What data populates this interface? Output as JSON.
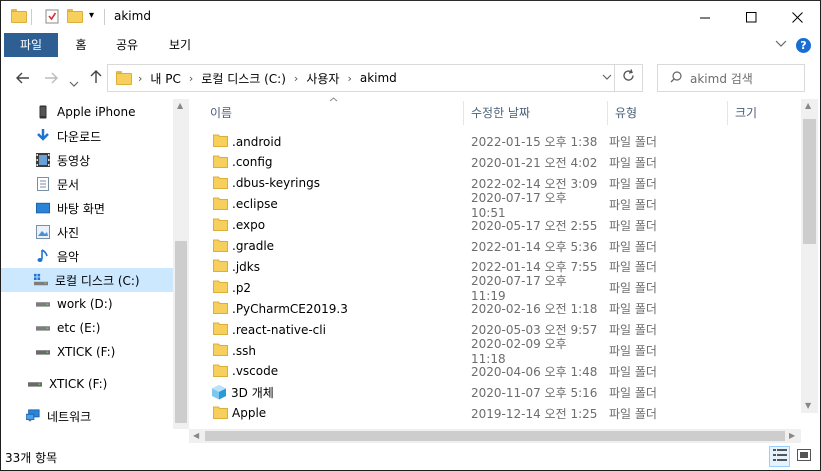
{
  "title": "akimd",
  "ribbon": {
    "tabs": [
      "파일",
      "홈",
      "공유",
      "보기"
    ]
  },
  "address": {
    "crumbs": [
      "내 PC",
      "로컬 디스크 (C:)",
      "사용자",
      "akimd"
    ]
  },
  "search": {
    "placeholder": "akimd 검색"
  },
  "nav": {
    "items": [
      {
        "label": "Apple iPhone",
        "icon": "phone-icon"
      },
      {
        "label": "다운로드",
        "icon": "download-icon"
      },
      {
        "label": "동영상",
        "icon": "video-icon"
      },
      {
        "label": "문서",
        "icon": "document-icon"
      },
      {
        "label": "바탕 화면",
        "icon": "desktop-icon"
      },
      {
        "label": "사진",
        "icon": "picture-icon"
      },
      {
        "label": "음악",
        "icon": "music-icon"
      },
      {
        "label": "로컬 디스크 (C:)",
        "icon": "drive-icon",
        "selected": true
      },
      {
        "label": "work (D:)",
        "icon": "drive-icon"
      },
      {
        "label": "etc (E:)",
        "icon": "drive-icon"
      },
      {
        "label": "XTICK (F:)",
        "icon": "usb-drive-icon"
      },
      {
        "label": "XTICK (F:)",
        "icon": "usb-drive-icon"
      },
      {
        "label": "네트워크",
        "icon": "network-icon"
      }
    ]
  },
  "columns": {
    "name": "이름",
    "date": "수정한 날짜",
    "type": "유형",
    "size": "크기"
  },
  "files": [
    {
      "name": ".android",
      "date": "2022-01-15 오후 1:38",
      "type": "파일 폴더",
      "icon": "folder-icon"
    },
    {
      "name": ".config",
      "date": "2020-01-21 오전 4:02",
      "type": "파일 폴더",
      "icon": "folder-icon"
    },
    {
      "name": ".dbus-keyrings",
      "date": "2022-02-14 오전 3:09",
      "type": "파일 폴더",
      "icon": "folder-icon"
    },
    {
      "name": ".eclipse",
      "date": "2020-07-17 오후 10:51",
      "type": "파일 폴더",
      "icon": "folder-icon"
    },
    {
      "name": ".expo",
      "date": "2020-05-17 오전 2:55",
      "type": "파일 폴더",
      "icon": "folder-icon"
    },
    {
      "name": ".gradle",
      "date": "2022-01-14 오후 5:36",
      "type": "파일 폴더",
      "icon": "folder-icon"
    },
    {
      "name": ".jdks",
      "date": "2022-01-14 오후 7:55",
      "type": "파일 폴더",
      "icon": "folder-icon"
    },
    {
      "name": ".p2",
      "date": "2020-07-17 오후 11:19",
      "type": "파일 폴더",
      "icon": "folder-icon"
    },
    {
      "name": ".PyCharmCE2019.3",
      "date": "2020-02-16 오전 1:18",
      "type": "파일 폴더",
      "icon": "folder-icon"
    },
    {
      "name": ".react-native-cli",
      "date": "2020-05-03 오전 9:57",
      "type": "파일 폴더",
      "icon": "folder-icon"
    },
    {
      "name": ".ssh",
      "date": "2020-02-09 오후 11:18",
      "type": "파일 폴더",
      "icon": "folder-icon"
    },
    {
      "name": ".vscode",
      "date": "2020-04-06 오후 1:48",
      "type": "파일 폴더",
      "icon": "folder-icon"
    },
    {
      "name": "3D 개체",
      "date": "2020-11-07 오후 5:16",
      "type": "파일 폴더",
      "icon": "3d-objects-icon"
    },
    {
      "name": "Apple",
      "date": "2019-12-14 오전 1:25",
      "type": "파일 폴더",
      "icon": "folder-icon"
    }
  ],
  "status": {
    "count": "33개 항목"
  },
  "colors": {
    "file_tab": "#2d5f93",
    "selection": "#cce8ff",
    "folder": "#f6cf5d"
  }
}
